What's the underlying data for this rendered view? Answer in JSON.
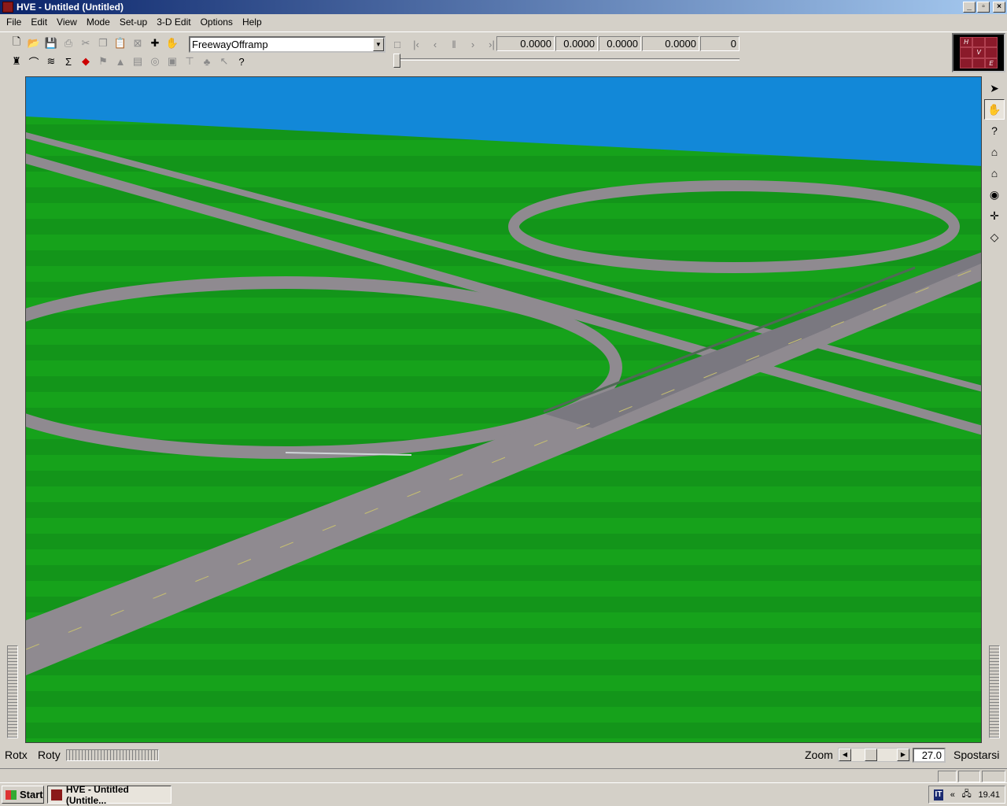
{
  "window": {
    "title": "HVE - Untitled (Untitled)"
  },
  "menu": [
    "File",
    "Edit",
    "View",
    "Mode",
    "Set-up",
    "3-D Edit",
    "Options",
    "Help"
  ],
  "toolbar": {
    "object_combo": "FreewayOfframp",
    "readouts": [
      "0.0000",
      "0.0000",
      "0.0000",
      "0.0000",
      "0"
    ],
    "help_glyph": "?"
  },
  "logo": {
    "letters": [
      "H",
      "V",
      "E"
    ]
  },
  "status": {
    "rotx_label": "Rotx",
    "roty_label": "Roty",
    "zoom_label": "Zoom",
    "zoom_value": "27.0",
    "pan_label": "Spostarsi"
  },
  "taskbar": {
    "start_label": "Start",
    "task_label": "HVE - Untitled (Untitle...",
    "tray_lang": "IT",
    "clock": "19.41"
  },
  "colors": {
    "sky": "#1288d8",
    "grass": "#15a31a",
    "road": "#8f8a90",
    "titlebar": "#0a246a"
  }
}
